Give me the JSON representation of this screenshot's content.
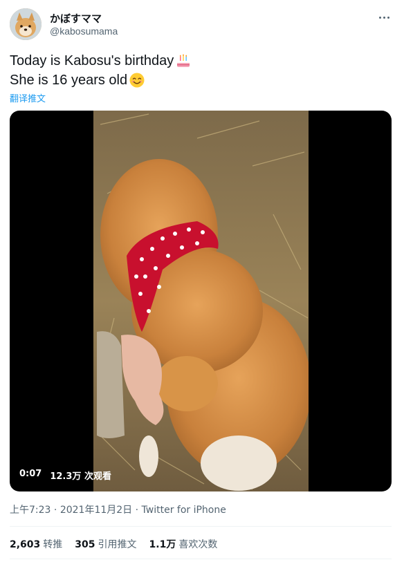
{
  "author": {
    "display_name": "かぼすママ",
    "handle": "@kabosumama",
    "avatar_icon": "shiba-dog-avatar"
  },
  "tweet": {
    "line1": "Today is Kabosu's birthday",
    "line1_emoji": "birthday-cake-icon",
    "line2": "She is 16 years old",
    "line2_emoji": "smiling-face-icon",
    "translate_label": "翻译推文"
  },
  "video": {
    "elapsed": "0:07",
    "views": "12.3万 次观看"
  },
  "meta": {
    "time": "上午7:23",
    "separator1": " · ",
    "date": "2021年11月2日",
    "separator2": " · ",
    "source": "Twitter for iPhone"
  },
  "stats": {
    "retweets_count": "2,603",
    "retweets_label": "转推",
    "quotes_count": "305",
    "quotes_label": "引用推文",
    "likes_count": "1.1万",
    "likes_label": "喜欢次数"
  },
  "colors": {
    "link": "#1d9bf0",
    "secondary": "#536471",
    "primary": "#0f1419",
    "divider": "#eff3f4"
  }
}
